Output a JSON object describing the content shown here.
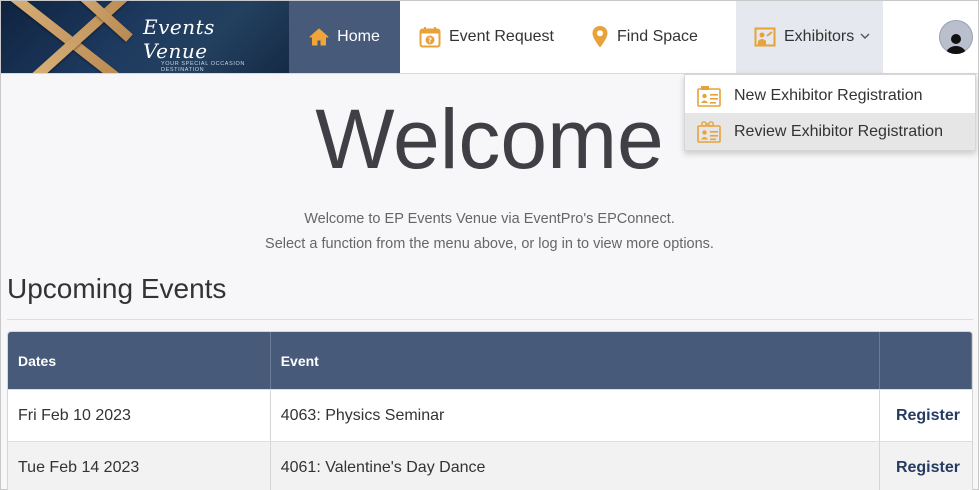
{
  "logo": {
    "name": "Events Venue",
    "tagline": "YOUR SPECIAL OCCASION DESTINATION"
  },
  "nav": {
    "home": "Home",
    "event_request": "Event Request",
    "find_space": "Find Space",
    "exhibitors": "Exhibitors"
  },
  "exhibitors_menu": [
    {
      "label": "New Exhibitor Registration",
      "icon": "id-card-icon"
    },
    {
      "label": "Review Exhibitor Registration",
      "icon": "id-card-glasses-icon"
    }
  ],
  "main": {
    "title": "Welcome",
    "intro_line1": "Welcome to EP Events Venue via EventPro's EPConnect.",
    "intro_line2": "Select a function from the menu above, or log in to view more options.",
    "section_title": "Upcoming Events"
  },
  "table": {
    "headers": [
      "Dates",
      "Event",
      ""
    ],
    "rows": [
      {
        "date": "Fri Feb 10 2023",
        "event": "4063: Physics Seminar",
        "action": "Register"
      },
      {
        "date": "Tue Feb 14 2023",
        "event": "4061: Valentine's Day Dance",
        "action": "Register"
      }
    ]
  },
  "colors": {
    "accent": "#485a7a",
    "icon_orange": "#e8a23a",
    "link": "#253b62"
  }
}
